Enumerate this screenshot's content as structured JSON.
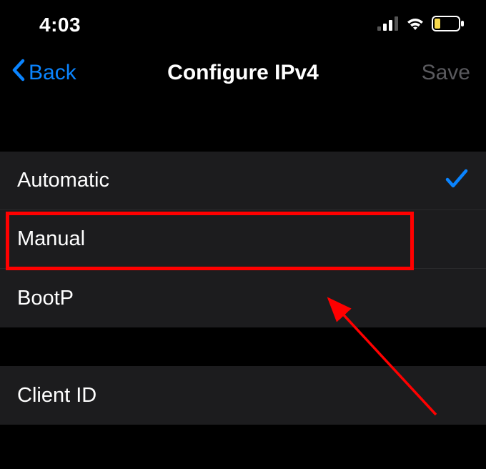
{
  "statusBar": {
    "time": "4:03"
  },
  "navBar": {
    "backLabel": "Back",
    "title": "Configure IPv4",
    "saveLabel": "Save"
  },
  "options": {
    "automatic": "Automatic",
    "manual": "Manual",
    "bootp": "BootP"
  },
  "clientId": {
    "label": "Client ID"
  },
  "selected": "automatic",
  "annotation": {
    "highlightTarget": "manual"
  }
}
